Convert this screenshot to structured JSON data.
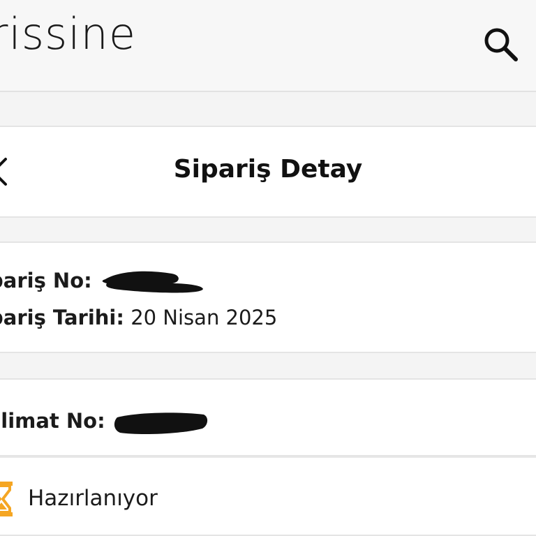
{
  "header": {
    "brand": "rissine",
    "search_icon": "search-icon"
  },
  "title_bar": {
    "title": "Sipariş Detay",
    "back_icon": "chevron-left-icon"
  },
  "order": {
    "order_no_label": "pariş No:",
    "order_no_value": "",
    "order_date_label": "pariş Tarihi:",
    "order_date_value": "20 Nisan 2025"
  },
  "delivery": {
    "delivery_no_label": "slimat No:",
    "delivery_no_value": ""
  },
  "status": {
    "icon": "hourglass-icon",
    "icon_color": "#f5a623",
    "label": "Hazırlanıyor"
  },
  "colors": {
    "background": "#efefef",
    "card": "#ffffff",
    "text": "#111111",
    "accent": "#f5a623"
  }
}
